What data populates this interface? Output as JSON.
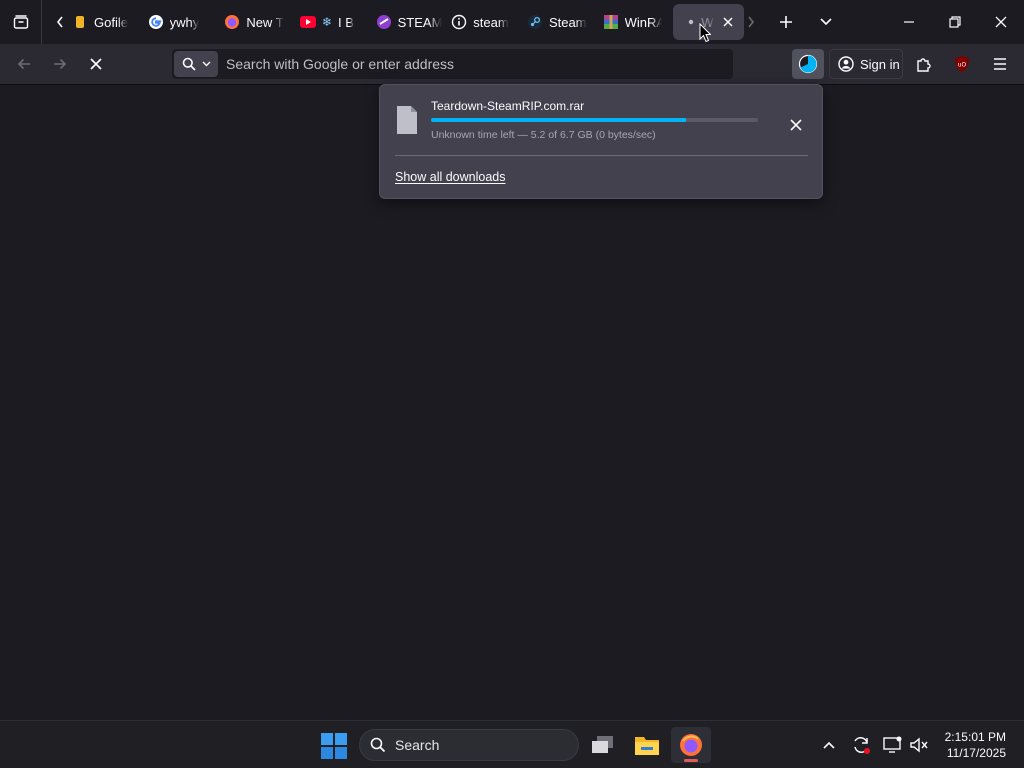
{
  "tabs": [
    {
      "label": "Gofile",
      "favicon": "gofile-icon"
    },
    {
      "label": "ywhy",
      "favicon": "google-icon"
    },
    {
      "label": "New T",
      "favicon": "firefox-icon"
    },
    {
      "label": "I B",
      "favicon": "youtube-icon"
    },
    {
      "label": "STEAM",
      "favicon": "steamrip-icon"
    },
    {
      "label": "steam",
      "favicon": "info-icon"
    },
    {
      "label": "Steam",
      "favicon": "steam-icon"
    },
    {
      "label": "WinRA",
      "favicon": "winrar-icon"
    },
    {
      "label": "W",
      "favicon": "loading-dot-icon",
      "active": true
    }
  ],
  "urlbar": {
    "placeholder": "Search with Google or enter address"
  },
  "toolbar": {
    "signin_label": "Sign in"
  },
  "downloads_panel": {
    "filename": "Teardown-SteamRIP.com.rar",
    "status": "Unknown time left — 5.2 of 6.7 GB (0 bytes/sec)",
    "progress": 0.78,
    "show_all_label": "Show all downloads"
  },
  "taskbar": {
    "search_label": "Search"
  },
  "clock": {
    "time": "2:15:01 PM",
    "date": "11/17/2025"
  },
  "colors": {
    "accent": "#00b3f4",
    "panel": "#42414d",
    "toolbar": "#2b2a33",
    "background": "#1c1b22"
  }
}
